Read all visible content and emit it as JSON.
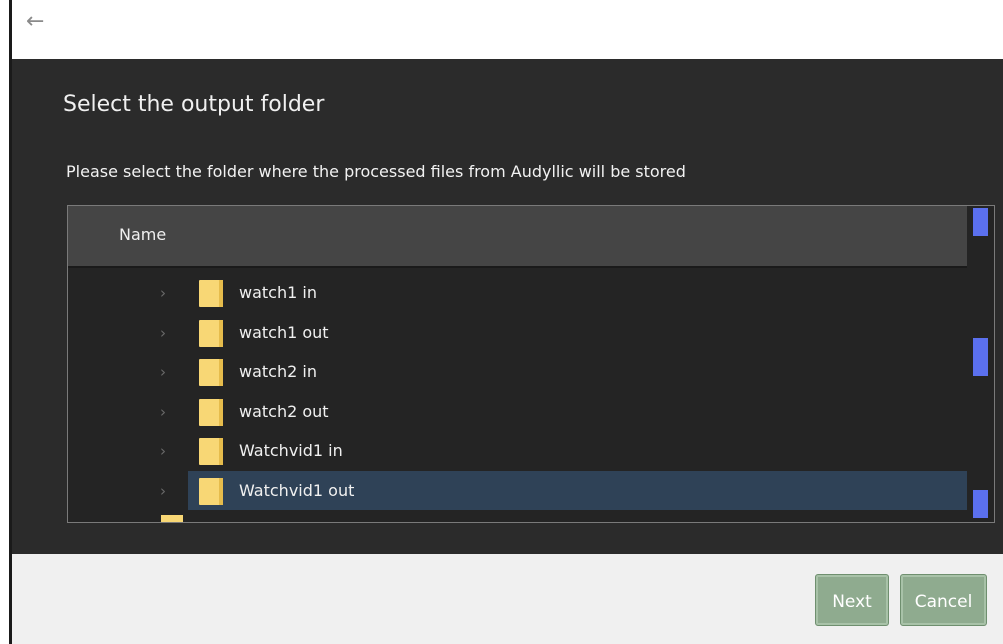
{
  "header": {
    "back_icon": "arrow-left-icon",
    "back_glyph": "←"
  },
  "dialog": {
    "title": "Select the output folder",
    "description": "Please select the folder where the processed files from Audyllic will be stored"
  },
  "tree": {
    "column_header": "Name",
    "chevron_glyph": "›",
    "rows": [
      {
        "label": "watch1 in",
        "selected": false
      },
      {
        "label": "watch1 out",
        "selected": false
      },
      {
        "label": "watch2 in",
        "selected": false
      },
      {
        "label": "watch2 out",
        "selected": false
      },
      {
        "label": "Watchvid1 in",
        "selected": false
      },
      {
        "label": "Watchvid1 out",
        "selected": true
      }
    ]
  },
  "buttons": {
    "next_label": "Next",
    "cancel_label": "Cancel"
  },
  "colors": {
    "panel_bg": "#2b2b2b",
    "header_bg": "#454545",
    "selection_bg": "#2f4257",
    "folder": "#f8d775",
    "scrollbar": "#5b70ee",
    "button_bg": "#8fab8f",
    "footer_bg": "#f0f0f0"
  }
}
